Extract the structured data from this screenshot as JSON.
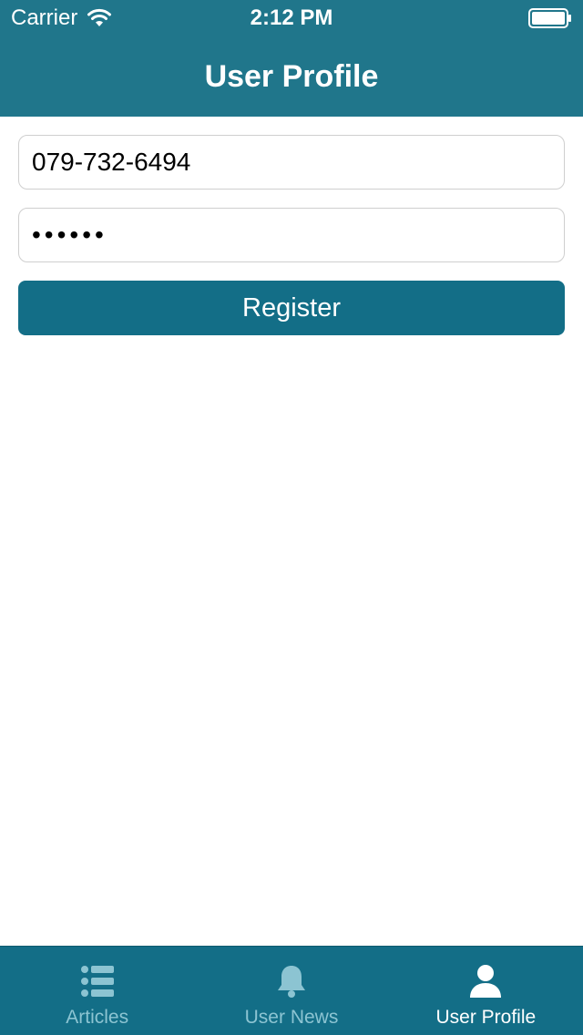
{
  "status_bar": {
    "carrier": "Carrier",
    "time": "2:12 PM"
  },
  "nav": {
    "title": "User Profile"
  },
  "form": {
    "phone_value": "079-732-6494",
    "password_value": "••••••",
    "register_label": "Register"
  },
  "tabs": [
    {
      "label": "Articles",
      "icon": "list-icon",
      "active": false
    },
    {
      "label": "User News",
      "icon": "bell-icon",
      "active": false
    },
    {
      "label": "User Profile",
      "icon": "user-icon",
      "active": true
    }
  ],
  "colors": {
    "header": "#20768b",
    "accent": "#136e87",
    "tab_inactive": "#8cc4d2",
    "tab_active": "#ffffff"
  }
}
